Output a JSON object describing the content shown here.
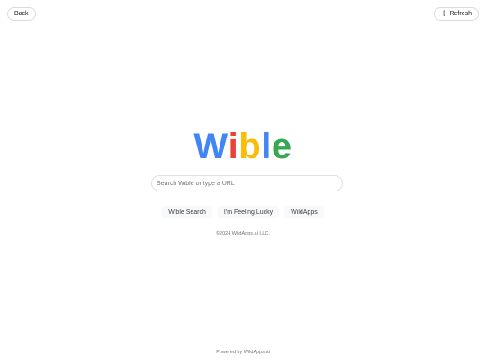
{
  "nav": {
    "back_label": "Back",
    "refresh_label": "Refresh",
    "refresh_icon": "refresh-icon"
  },
  "logo": {
    "letters": [
      {
        "char": "W",
        "color": "#4285F4"
      },
      {
        "char": "i",
        "color": "#EA4335"
      },
      {
        "char": "b",
        "color": "#FBBC05"
      },
      {
        "char": "l",
        "color": "#4285F4"
      },
      {
        "char": "e",
        "color": "#34A853"
      }
    ]
  },
  "search": {
    "placeholder": "Search Wible or type a URL",
    "value": ""
  },
  "actions": {
    "search_label": "Wible Search",
    "lucky_label": "I'm Feeling Lucky",
    "apps_label": "WildApps"
  },
  "copyright": "©2024 WildApps.ai LLC.",
  "footer": "Powered by WildApps.ai"
}
